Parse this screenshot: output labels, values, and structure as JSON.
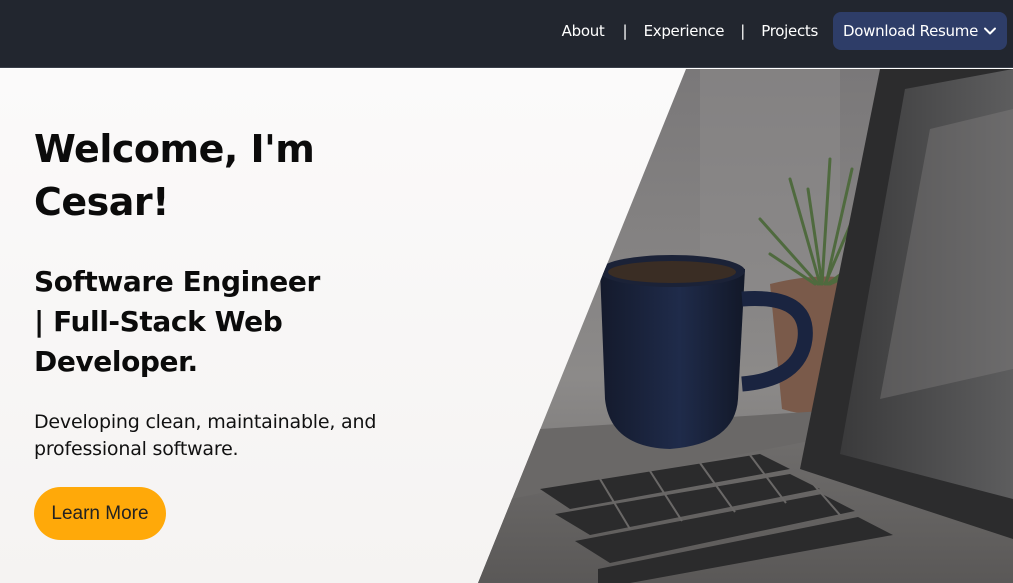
{
  "nav": {
    "about": "About",
    "separator": "|",
    "experience": "Experience",
    "projects": "Projects",
    "resume_button": "Download Resume",
    "resume_icon": "chevron-down-icon"
  },
  "hero": {
    "title": "Welcome, I'm Cesar!",
    "subtitle": "Software Engineer | Full-Stack Web Developer.",
    "tagline": "Developing clean, maintainable, and professional software.",
    "cta_label": "Learn More",
    "image": "laptop-coffee-plant-photo"
  },
  "colors": {
    "navbar_bg": "#22262f",
    "resume_button_bg": "#2e3d68",
    "cta_bg": "#ffa909",
    "hero_bg": "#f8f7f6"
  }
}
